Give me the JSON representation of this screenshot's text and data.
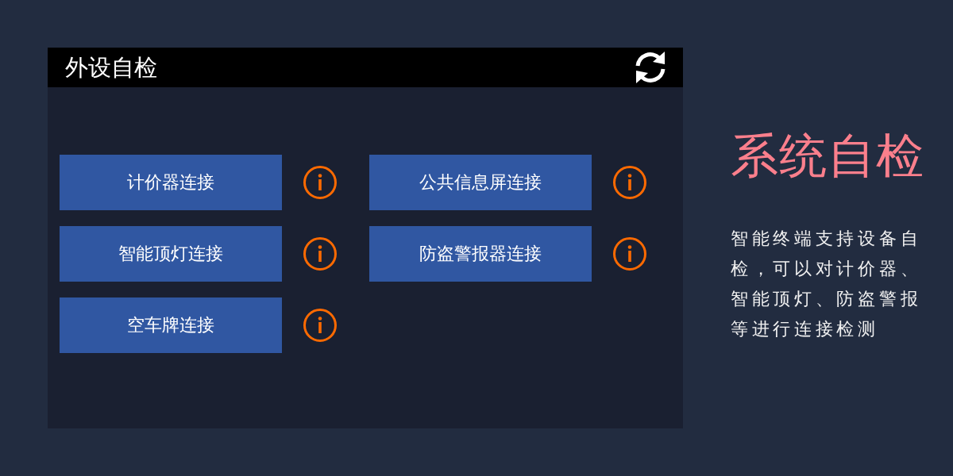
{
  "panel": {
    "title": "外设自检"
  },
  "devices": [
    {
      "label": "计价器连接"
    },
    {
      "label": "公共信息屏连接"
    },
    {
      "label": "智能顶灯连接"
    },
    {
      "label": "防盗警报器连接"
    },
    {
      "label": "空车牌连接"
    }
  ],
  "side": {
    "heading": "系统自检",
    "description": "智能终端支持设备自检，可以对计价器、智能顶灯、防盗警报等进行连接检测"
  }
}
